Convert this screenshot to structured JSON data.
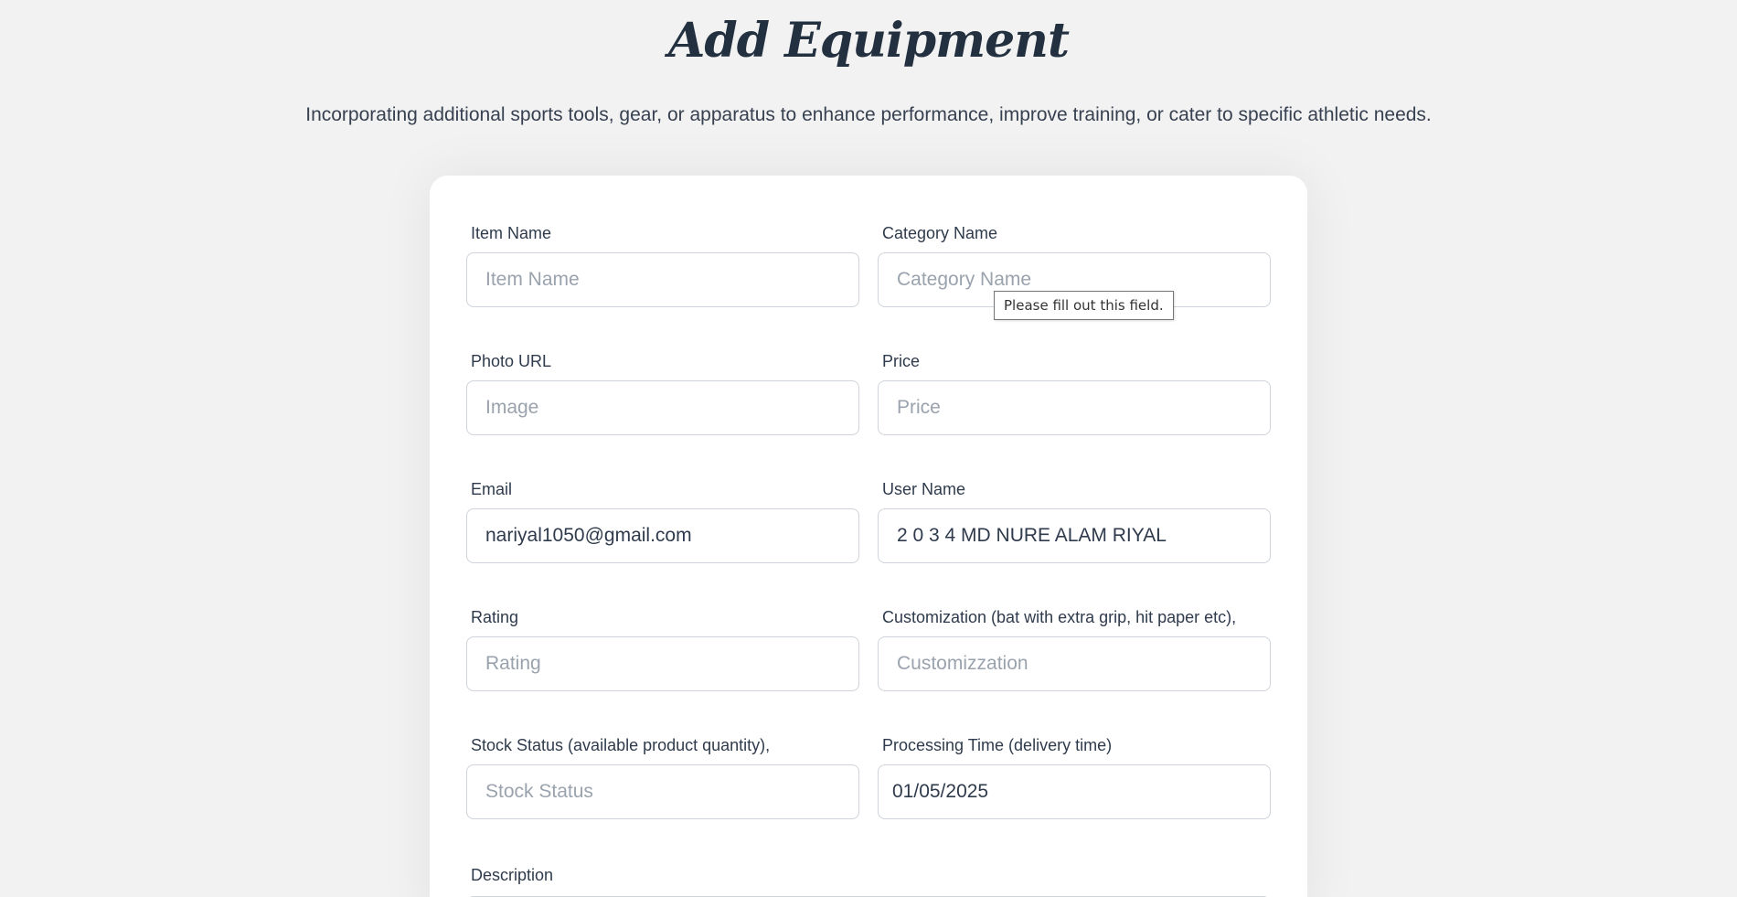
{
  "header": {
    "title": "Add Equipment",
    "subtitle": "Incorporating additional sports tools, gear, or apparatus to enhance performance, improve training, or cater to specific athletic needs."
  },
  "form": {
    "item_name": {
      "label": "Item Name",
      "placeholder": "Item Name",
      "value": ""
    },
    "category_name": {
      "label": "Category Name",
      "placeholder": "Category Name",
      "value": ""
    },
    "photo_url": {
      "label": "Photo URL",
      "placeholder": "Image",
      "value": ""
    },
    "price": {
      "label": "Price",
      "placeholder": "Price",
      "value": ""
    },
    "email": {
      "label": "Email",
      "placeholder": "",
      "value": "nariyal1050@gmail.com"
    },
    "user_name": {
      "label": "User Name",
      "placeholder": "",
      "value": "2 0 3 4 MD NURE ALAM RIYAL"
    },
    "rating": {
      "label": "Rating",
      "placeholder": "Rating",
      "value": ""
    },
    "customization": {
      "label": "Customization (bat with extra grip, hit paper etc),",
      "placeholder": "Customizzation",
      "value": ""
    },
    "stock_status": {
      "label": "Stock Status (available product quantity),",
      "placeholder": "Stock Status",
      "value": ""
    },
    "processing_time": {
      "label": "Processing Time (delivery time)",
      "placeholder": "",
      "value": "01/05/2025"
    },
    "description": {
      "label": "Description"
    }
  },
  "validation_tooltip": "Please fill out this field."
}
